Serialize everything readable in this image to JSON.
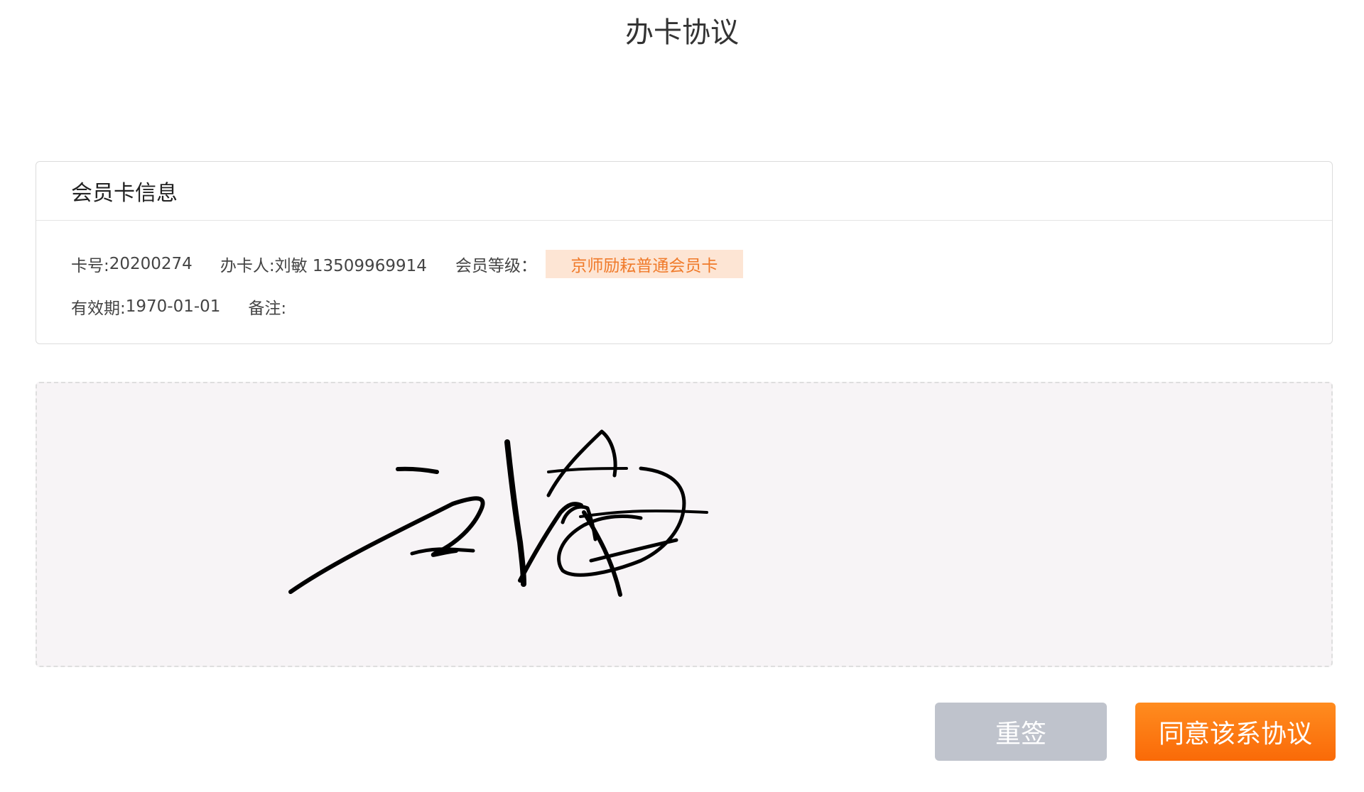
{
  "page": {
    "title": "办卡协议"
  },
  "card_info": {
    "header": "会员卡信息",
    "card_no_label": "卡号:",
    "card_no_value": "20200274",
    "holder_label": "办卡人:",
    "holder_value": "刘敏 13509969914",
    "level_label": "会员等级：",
    "level_value": "京师励耘普通会员卡",
    "validity_label": "有效期:",
    "validity_value": "1970-01-01",
    "remark_label": "备注:",
    "remark_value": ""
  },
  "signature": {
    "has_signature": true,
    "background_color": "#f7f4f6",
    "stroke_color": "#000000"
  },
  "actions": {
    "resign_label": "重签",
    "agree_label": "同意该系协议"
  },
  "colors": {
    "accent": "#fa7a10",
    "badge_bg": "#fde5d4",
    "badge_text": "#f07a2a",
    "disabled_button": "#bfc3cc"
  }
}
